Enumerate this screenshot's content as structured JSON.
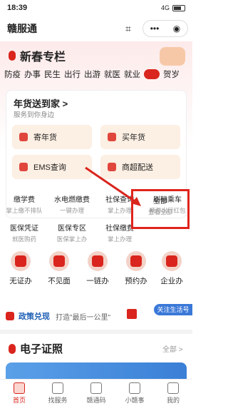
{
  "status": {
    "time": "18:39",
    "network": "4G"
  },
  "app": {
    "title": "赣服通"
  },
  "festival": {
    "title": "新春专栏",
    "tabs": [
      "防疫",
      "办事",
      "民生",
      "出行",
      "出游",
      "就医",
      "就业",
      "贺岁"
    ],
    "card": {
      "title": "年货送到家 >",
      "subtitle": "服务到你身边",
      "tiles": [
        "寄年货",
        "买年货",
        "EMS查询",
        "商超配送"
      ]
    }
  },
  "services": [
    {
      "name": "缴学费",
      "sub": "掌上缴不排队"
    },
    {
      "name": "水电燃缴费",
      "sub": "一键办理"
    },
    {
      "name": "社保查询",
      "sub": "掌上办理"
    },
    {
      "name": "刷码乘车",
      "sub": "畅游出行红包"
    },
    {
      "name": "医保凭证",
      "sub": "就医购药"
    },
    {
      "name": "医保专区",
      "sub": "医保掌上办"
    },
    {
      "name": "社保缴费",
      "sub": "掌上办理"
    },
    {
      "name": "全部",
      "sub": "查看全部"
    }
  ],
  "quick": [
    "无证办",
    "不见面",
    "一链办",
    "预约办",
    "企业办"
  ],
  "policy": {
    "title": "政策兑现",
    "desc": "打造\"最后一公里\"",
    "follow": "关注生活号"
  },
  "ecert": {
    "title": "电子证照",
    "all": "全部 >"
  },
  "tabbar": [
    "首页",
    "找服务",
    "赣通码",
    "小赣事",
    "我的"
  ]
}
